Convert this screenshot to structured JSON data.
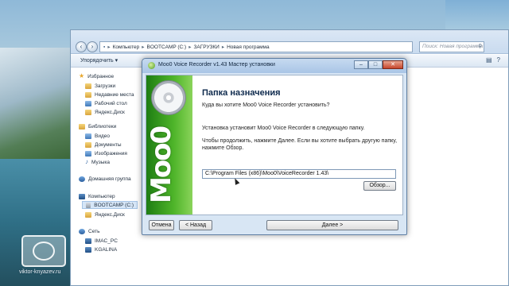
{
  "explorer": {
    "breadcrumb": [
      "Компьютер",
      "BOOTCAMP (C:)",
      "ЗАГРУЗКИ",
      "Новая программа"
    ],
    "search_placeholder": "Поиск: Новая программа",
    "organize_label": "Упорядочить ▾",
    "sidebar": {
      "favorites": "Избранное",
      "fav_items": [
        "Загрузки",
        "Недавние места",
        "Рабочий стол",
        "Яндекс.Диск"
      ],
      "libraries": "Библиотеки",
      "lib_items": [
        "Видео",
        "Документы",
        "Изображения",
        "Музыка"
      ],
      "homegroup": "Домашняя группа",
      "computer": "Компьютер",
      "comp_items": [
        "BOOTCAMP (C:)",
        "Яндекс.Диск"
      ],
      "network": "Сеть",
      "net_items": [
        "IMAC_PC",
        "KGALINA"
      ]
    }
  },
  "dialog": {
    "title": "Moo0 Voice Recorder v1.43 Мастер установки",
    "banner_text": "Moo0",
    "heading": "Папка назначения",
    "question": "Куда вы хотите Moo0 Voice Recorder установить?",
    "line1": "Установка установит Moo0 Voice Recorder в следующую папку.",
    "line2": "Чтобы продолжить, нажмите Далее. Если вы хотите выбрать другую папку, нажмите Обзор.",
    "path": "C:\\Program Files (x86)\\Moo0\\VoiceRecorder 1.43\\",
    "browse_label": "Обзор...",
    "cancel_label": "Отмена",
    "back_label": "< Назад",
    "next_label": "Далее >"
  },
  "watermark": "viktor-knyazev.ru"
}
